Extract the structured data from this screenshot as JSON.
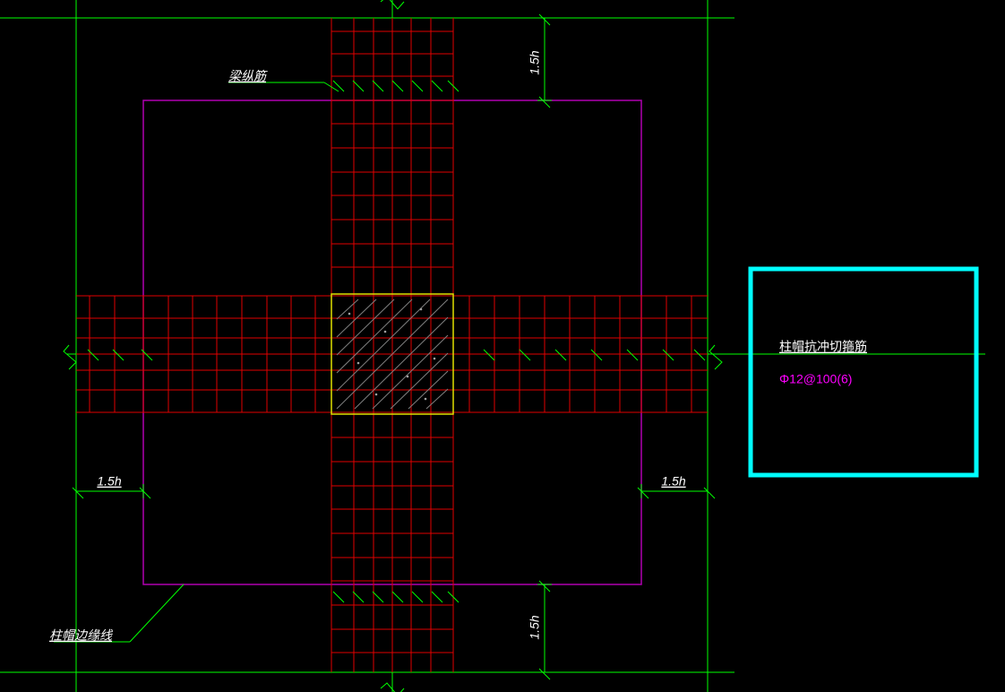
{
  "labels": {
    "beam_longitudinal_rebar": "梁纵筋",
    "column_cap_edge_line": "柱帽边缘线",
    "column_cap_punching_stirrup": "柱帽抗冲切箍筋",
    "rebar_spec": "Φ12@100(6)"
  },
  "dimensions": {
    "top": "1.5h",
    "left": "1.5h",
    "right": "1.5h",
    "bottom": "1.5h"
  },
  "legend": {
    "border_color": "#00ffff"
  },
  "colors": {
    "rebar_grid": "#e00000",
    "axis_dim": "#00ff00",
    "column_cap_outline": "#b000b0",
    "column_outline": "#e0e000",
    "legend_border": "#00ffff",
    "spec_text": "#ff00ff"
  }
}
